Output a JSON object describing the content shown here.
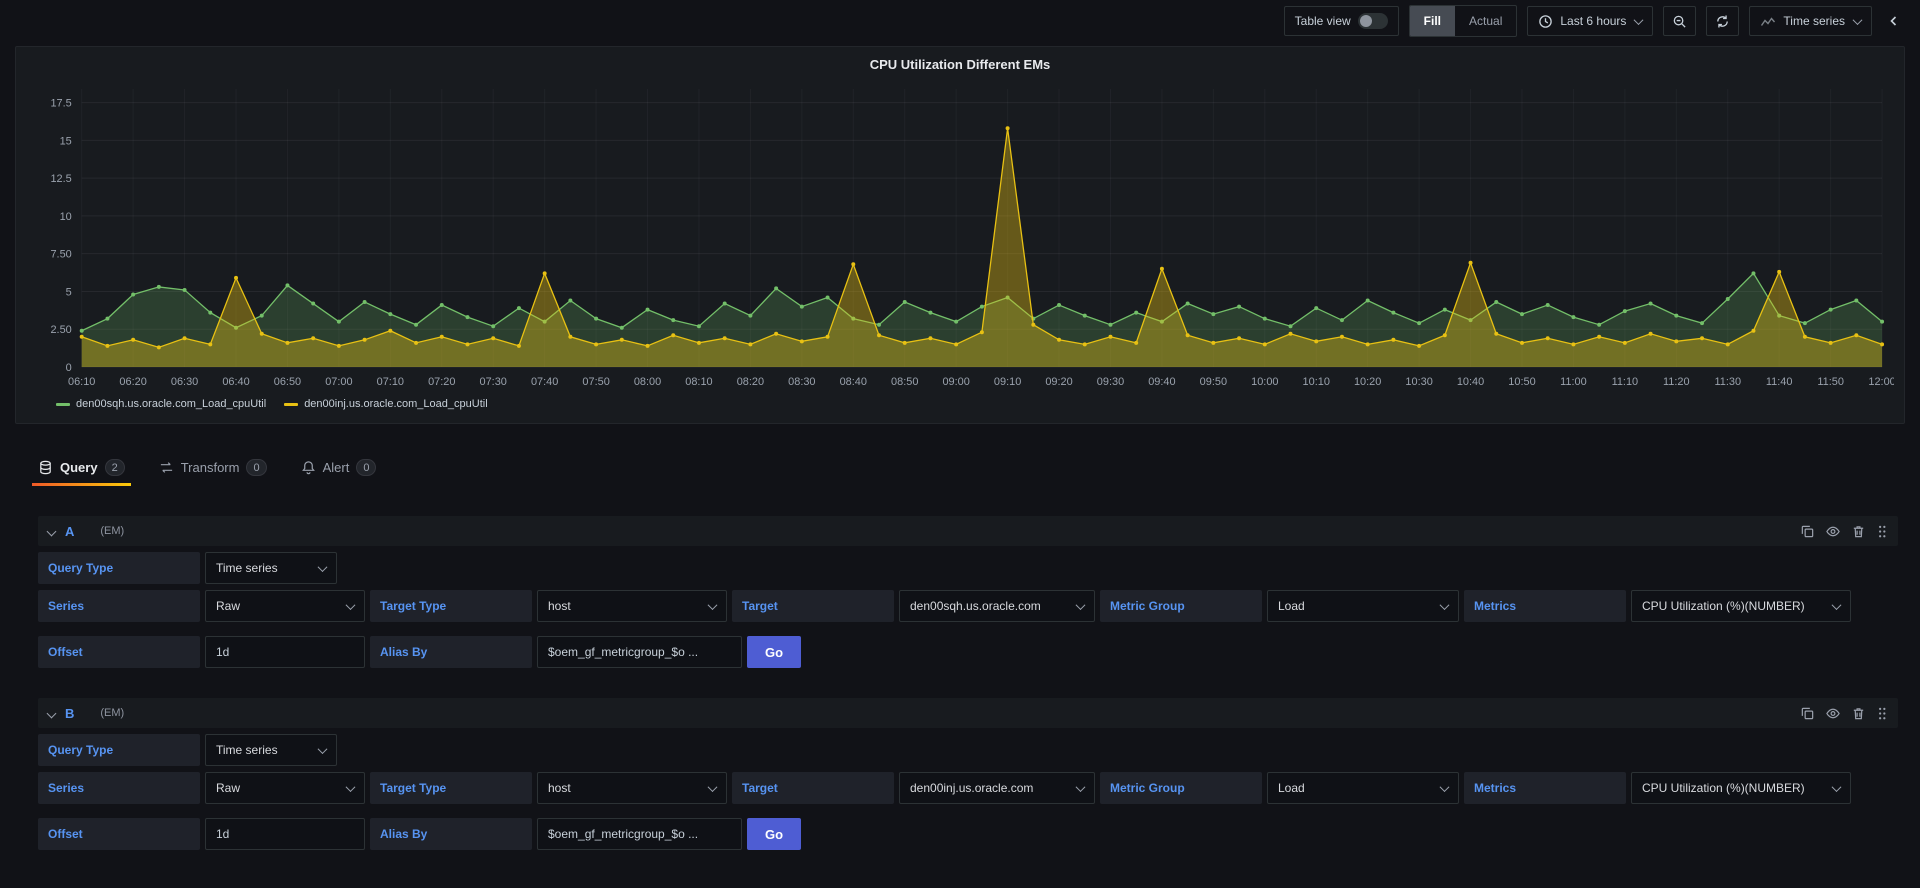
{
  "colors": {
    "accent_label": "#5794f2",
    "go_button": "#4e5dd3",
    "tab_active_underline": "#eb7b18",
    "series_green": "#73bf69",
    "series_yellow": "#e8c113"
  },
  "toolbar": {
    "table_view_label": "Table view",
    "fill_label": "Fill",
    "actual_label": "Actual",
    "time_range_label": "Last 6 hours",
    "vis_picker_label": "Time series",
    "icons": [
      "clock-icon",
      "zoom-out-icon",
      "refresh-icon",
      "chart-icon",
      "angle-left-icon"
    ]
  },
  "panel": {
    "title": "CPU Utilization Different EMs"
  },
  "chart_data": {
    "type": "line",
    "title": "CPU Utilization Different EMs",
    "xlabel": "",
    "ylabel": "",
    "ylim": [
      0,
      18.4
    ],
    "ytick_values": [
      0,
      2.5,
      5,
      7.5,
      10,
      12.5,
      15,
      17.5
    ],
    "ytick_labels": [
      "0",
      "2.50",
      "5",
      "7.50",
      "10",
      "12.5",
      "15",
      "17.5"
    ],
    "grid": true,
    "legend_position": "bottom-left",
    "x_labels": [
      "06:10",
      "06:20",
      "06:30",
      "06:40",
      "06:50",
      "07:00",
      "07:10",
      "07:20",
      "07:30",
      "07:40",
      "07:50",
      "08:00",
      "08:10",
      "08:20",
      "08:30",
      "08:40",
      "08:50",
      "09:00",
      "09:10",
      "09:20",
      "09:30",
      "09:40",
      "09:50",
      "10:00",
      "10:10",
      "10:20",
      "10:30",
      "10:40",
      "10:50",
      "11:00",
      "11:10",
      "11:20",
      "11:30",
      "11:40",
      "11:50",
      "12:00"
    ],
    "points_per_label": 2,
    "series": [
      {
        "name": "den00sqh.us.oracle.com_Load_cpuUtil",
        "color": "#73bf69",
        "fill_opacity": 0.22,
        "values": [
          2.4,
          3.2,
          4.8,
          5.3,
          5.1,
          3.6,
          2.6,
          3.4,
          5.4,
          4.2,
          3.0,
          4.3,
          3.5,
          2.8,
          4.1,
          3.3,
          2.7,
          3.9,
          3.0,
          4.4,
          3.2,
          2.6,
          3.8,
          3.1,
          2.7,
          4.2,
          3.4,
          5.2,
          4.0,
          4.6,
          3.2,
          2.8,
          4.3,
          3.6,
          3.0,
          4.0,
          4.6,
          3.2,
          4.1,
          3.4,
          2.8,
          3.6,
          3.0,
          4.2,
          3.5,
          4.0,
          3.2,
          2.7,
          3.9,
          3.1,
          4.4,
          3.6,
          2.9,
          3.8,
          3.1,
          4.3,
          3.5,
          4.1,
          3.3,
          2.8,
          3.7,
          4.2,
          3.4,
          2.9,
          4.5,
          6.2,
          3.4,
          2.9,
          3.8,
          4.4,
          3.0
        ]
      },
      {
        "name": "den00inj.us.oracle.com_Load_cpuUtil",
        "color": "#e8c113",
        "fill_opacity": 0.38,
        "values": [
          2.0,
          1.4,
          1.8,
          1.3,
          1.9,
          1.5,
          5.9,
          2.2,
          1.6,
          1.9,
          1.4,
          1.8,
          2.4,
          1.6,
          2.0,
          1.5,
          1.9,
          1.4,
          6.2,
          2.0,
          1.5,
          1.8,
          1.4,
          2.1,
          1.6,
          1.9,
          1.5,
          2.2,
          1.7,
          2.0,
          6.8,
          2.1,
          1.6,
          1.9,
          1.5,
          2.3,
          15.8,
          2.8,
          1.8,
          1.5,
          2.0,
          1.6,
          6.5,
          2.1,
          1.6,
          1.9,
          1.5,
          2.2,
          1.7,
          2.0,
          1.5,
          1.8,
          1.4,
          2.1,
          6.9,
          2.2,
          1.6,
          1.9,
          1.5,
          2.0,
          1.6,
          2.2,
          1.7,
          1.9,
          1.5,
          2.4,
          6.3,
          2.0,
          1.6,
          2.1,
          1.5
        ]
      }
    ]
  },
  "tabs": [
    {
      "label": "Query",
      "count": "2",
      "icon": "database-icon"
    },
    {
      "label": "Transform",
      "count": "0",
      "icon": "transform-icon"
    },
    {
      "label": "Alert",
      "count": "0",
      "icon": "bell-icon"
    }
  ],
  "field_labels": {
    "query_type": "Query Type",
    "series": "Series",
    "target_type": "Target Type",
    "target": "Target",
    "metric_group": "Metric Group",
    "metrics": "Metrics",
    "offset": "Offset",
    "alias_by": "Alias By"
  },
  "actions": {
    "go": "Go"
  },
  "queries": [
    {
      "ref": "A",
      "datasource": "(EM)",
      "query_type": "Time series",
      "series": "Raw",
      "target_type": "host",
      "target": "den00sqh.us.oracle.com",
      "metric_group": "Load",
      "metrics": "CPU Utilization (%)(NUMBER)",
      "offset": "1d",
      "alias_by": "$oem_gf_metricgroup_$o ...",
      "go": "Go"
    },
    {
      "ref": "B",
      "datasource": "(EM)",
      "query_type": "Time series",
      "series": "Raw",
      "target_type": "host",
      "target": "den00inj.us.oracle.com",
      "metric_group": "Load",
      "metrics": "CPU Utilization (%)(NUMBER)",
      "offset": "1d",
      "alias_by": "$oem_gf_metricgroup_$o ...",
      "go": "Go"
    }
  ]
}
